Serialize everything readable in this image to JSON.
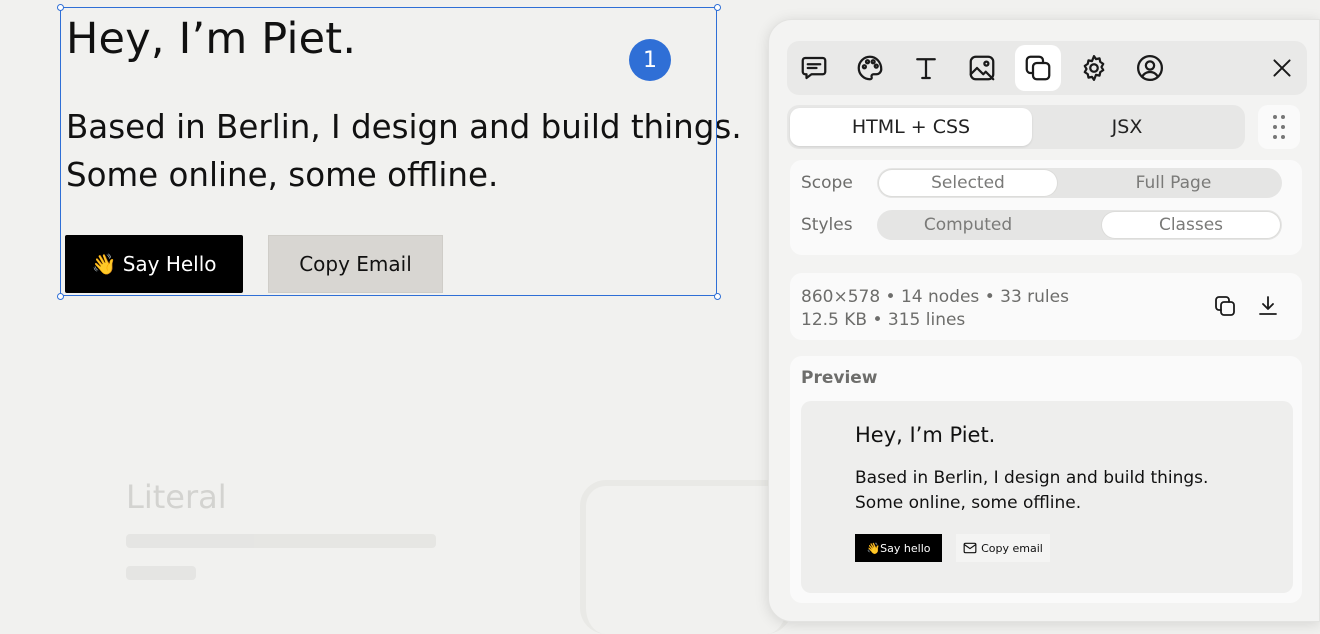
{
  "page": {
    "hero_title": "Hey, I’m Piet.",
    "hero_line1": "Based in Berlin, I design and build things.",
    "hero_line2": "Some online, some offline.",
    "say_hello": "👋 Say Hello",
    "copy_email": "Copy Email",
    "selection_badge": "1",
    "faded_heading": "Literal"
  },
  "panel": {
    "toolbar": [
      {
        "name": "comment-icon"
      },
      {
        "name": "palette-icon"
      },
      {
        "name": "text-icon"
      },
      {
        "name": "image-icon"
      },
      {
        "name": "copy-layers-icon",
        "active": true
      },
      {
        "name": "gear-icon"
      },
      {
        "name": "user-icon"
      }
    ],
    "format_tabs": [
      "HTML + CSS",
      "JSX"
    ],
    "format_active": "HTML + CSS",
    "scope_label": "Scope",
    "scope_options": [
      "Selected",
      "Full Page"
    ],
    "scope_selected": "Selected",
    "styles_label": "Styles",
    "styles_options": [
      "Computed",
      "Classes"
    ],
    "styles_selected": "Classes",
    "stats_line1": "860×578 • 14 nodes • 33 rules",
    "stats_line2": "12.5 KB • 315 lines",
    "preview_label": "Preview",
    "preview": {
      "title": "Hey, I’m Piet.",
      "line1": "Based in Berlin, I design and build things.",
      "line2": "Some online, some offline.",
      "say_hello": "👋Say hello",
      "copy_email": "Copy email"
    }
  },
  "colors": {
    "selection": "#2f6fd6",
    "page_bg": "#f1f1ef",
    "primary_button": "#000000",
    "secondary_button": "#d8d6d2"
  }
}
